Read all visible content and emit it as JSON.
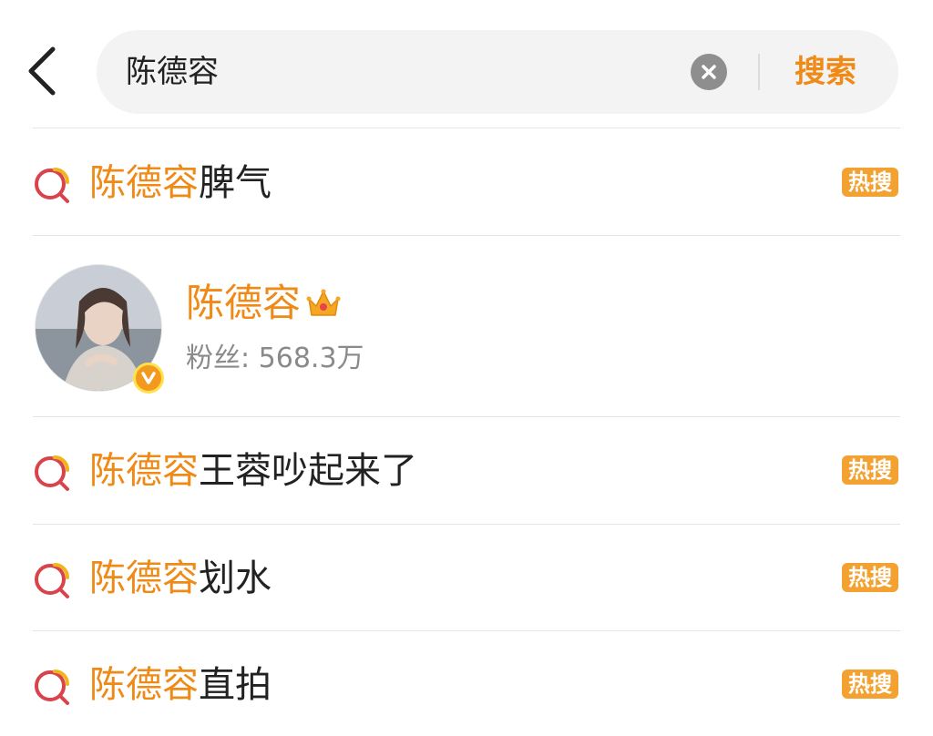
{
  "header": {
    "search_value": "陈德容",
    "search_button_label": "搜索"
  },
  "colors": {
    "accent": "#ef8a16",
    "badge": "#f3a231",
    "text": "#222222",
    "muted": "#8a8a8a",
    "search_icon": "#d9434b"
  },
  "suggestions": [
    {
      "highlight": "陈德容",
      "rest": "脾气",
      "badge": "热搜",
      "icon": "search-swirl-icon"
    },
    {
      "highlight": "陈德容",
      "rest": "王蓉吵起来了",
      "badge": "热搜",
      "icon": "search-swirl-icon"
    },
    {
      "highlight": "陈德容",
      "rest": "划水",
      "badge": "热搜",
      "icon": "search-swirl-icon"
    },
    {
      "highlight": "陈德容",
      "rest": "直拍",
      "badge": "热搜",
      "icon": "search-swirl-icon"
    }
  ],
  "user": {
    "name": "陈德容",
    "fans_label": "粉丝: 568.3万",
    "badge_icon": "crown-icon",
    "verified_icon": "verified-v-icon"
  }
}
